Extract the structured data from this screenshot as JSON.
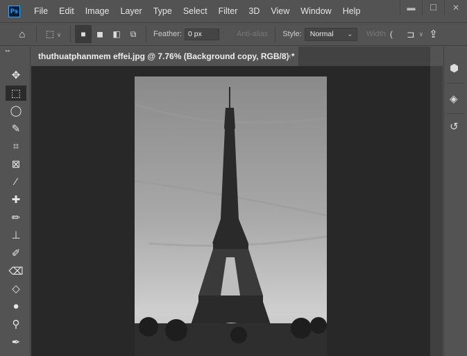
{
  "app": {
    "logo": "Ps"
  },
  "menu": [
    "File",
    "Edit",
    "Image",
    "Layer",
    "Type",
    "Select",
    "Filter",
    "3D",
    "View",
    "Window",
    "Help"
  ],
  "window_controls": {
    "minimize": "minimize-icon",
    "maximize": "maximize-icon",
    "close": "close-icon"
  },
  "options": {
    "feather_label": "Feather:",
    "feather_value": "0 px",
    "antialias_label": "Anti-alias",
    "style_label": "Style:",
    "style_value": "Normal",
    "width_label": "Width"
  },
  "document": {
    "tab_title": "thuthuatphanmem effei.jpg @ 7.76% (Background copy, RGB/8) *",
    "close": "×"
  },
  "tools": [
    "move",
    "rectangular-marquee",
    "lasso",
    "quick-selection",
    "crop",
    "frame",
    "eyedropper",
    "healing-brush",
    "pencil",
    "clone-stamp",
    "history-brush",
    "eraser",
    "paint-bucket",
    "blur",
    "dodge",
    "pen"
  ],
  "active_tool": "rectangular-marquee",
  "right_panels": [
    "3d-icon",
    "layers-icon",
    "history-icon"
  ]
}
